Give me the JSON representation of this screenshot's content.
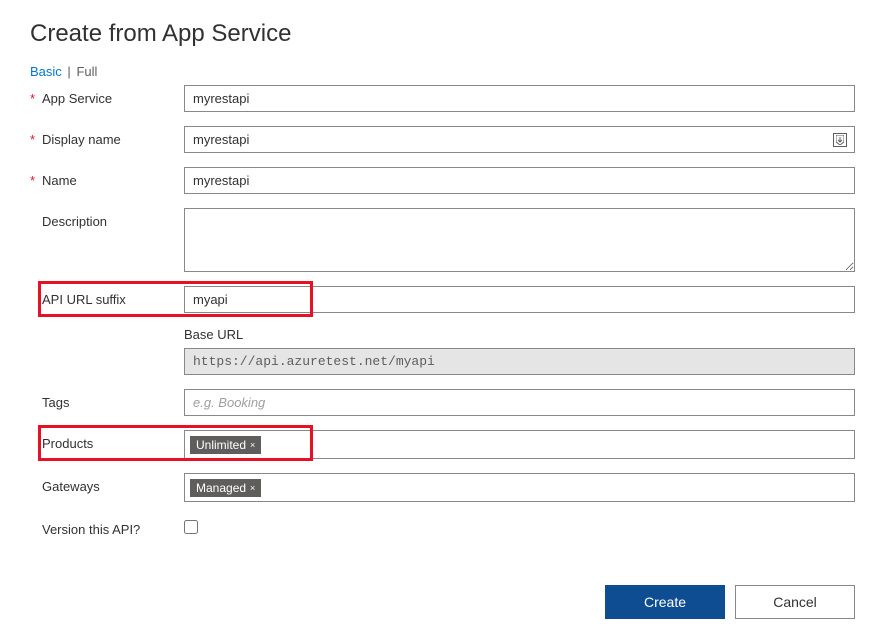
{
  "title": "Create from App Service",
  "tabs": {
    "basic": "Basic",
    "full": "Full",
    "separator": "|"
  },
  "fields": {
    "appService": {
      "label": "App Service",
      "value": "myrestapi"
    },
    "displayName": {
      "label": "Display name",
      "value": "myrestapi"
    },
    "name": {
      "label": "Name",
      "value": "myrestapi"
    },
    "description": {
      "label": "Description",
      "value": ""
    },
    "apiUrlSuffix": {
      "label": "API URL suffix",
      "value": "myapi"
    },
    "baseUrl": {
      "label": "Base URL",
      "value": "https://api.azuretest.net/myapi"
    },
    "tags": {
      "label": "Tags",
      "placeholder": "e.g. Booking"
    },
    "products": {
      "label": "Products",
      "chip": "Unlimited"
    },
    "gateways": {
      "label": "Gateways",
      "chip": "Managed"
    },
    "versionThisApi": {
      "label": "Version this API?"
    }
  },
  "buttons": {
    "create": "Create",
    "cancel": "Cancel"
  },
  "asterisk": "*",
  "chipClose": "×"
}
